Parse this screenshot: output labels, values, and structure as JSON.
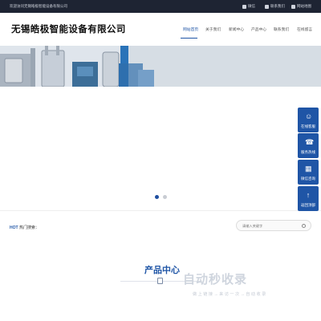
{
  "topbar": {
    "welcome": "欢迎访问无锡皓极智能设备有限公司",
    "links": [
      "微信",
      "联系我们",
      "网站地图"
    ]
  },
  "header": {
    "logo": "无锡皓极智能设备有限公司",
    "nav": [
      "网站首页",
      "关于我们",
      "新闻中心",
      "产品中心",
      "联系我们",
      "在线留言"
    ],
    "active_nav": "网站首页"
  },
  "hot": {
    "label_prefix": "HOT",
    "label": "热门搜索：",
    "search_placeholder": "请输入关键字"
  },
  "products": {
    "title": "产品中心"
  },
  "side": [
    "在线客服",
    "服务热线",
    "微信咨询",
    "返回顶部"
  ],
  "carousel": {
    "slides": 2,
    "active": 1
  },
  "watermark": {
    "title": "自动秒收录",
    "sub": "做 上 链 接 → 来 访 一 次 → 自 动 收 录"
  },
  "colors": {
    "accent": "#1f55a6",
    "topbar": "#1e2433"
  }
}
